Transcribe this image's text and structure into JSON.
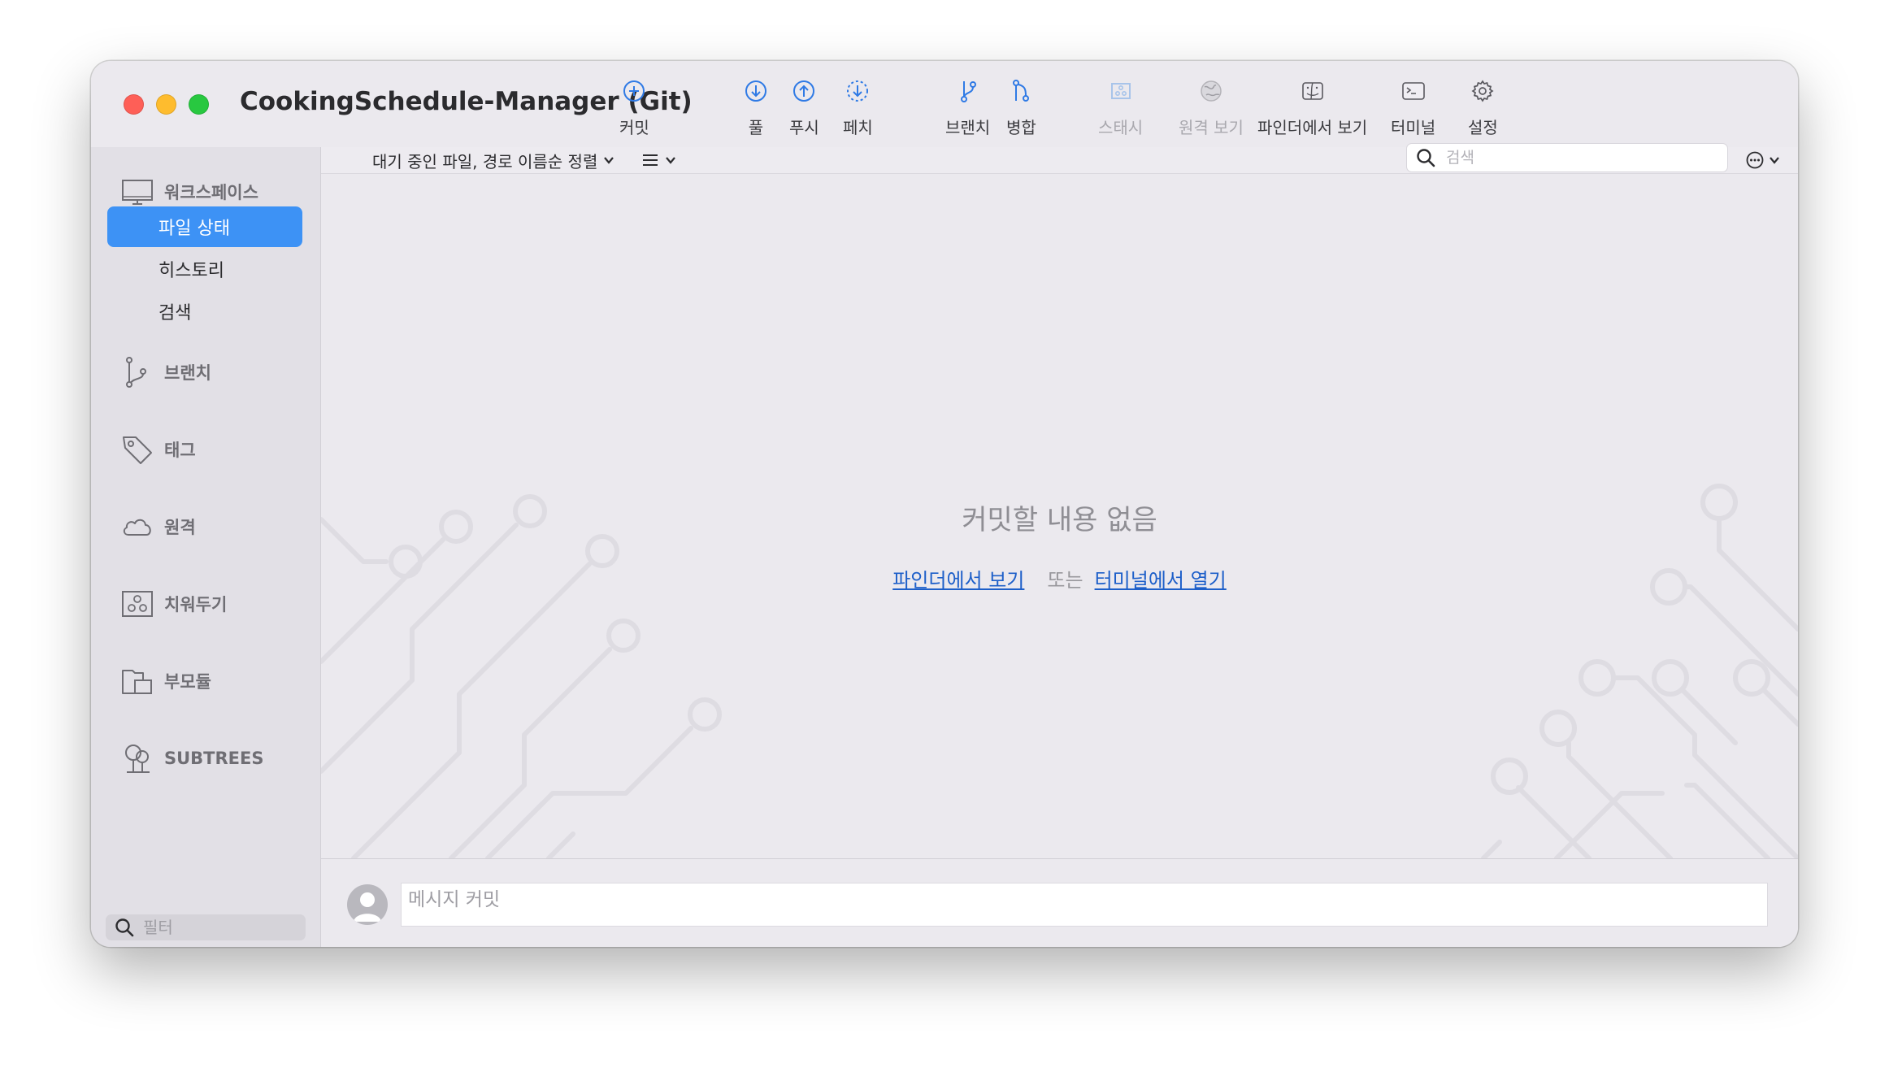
{
  "window": {
    "title": "CookingSchedule-Manager (Git)"
  },
  "toolbar": {
    "commit": "커밋",
    "pull": "풀",
    "push": "푸시",
    "fetch": "페치",
    "branch": "브랜치",
    "merge": "병합",
    "stash": "스태시",
    "remote_view": "원격 보기",
    "show_in_finder": "파인더에서 보기",
    "terminal": "터미널",
    "settings": "설정"
  },
  "sidebar": {
    "workspace": "워크스페이스",
    "file_status": "파일 상태",
    "history": "히스토리",
    "search": "검색",
    "branches": "브랜치",
    "tags": "태그",
    "remotes": "원격",
    "stashes": "치워두기",
    "submodules": "부모듈",
    "subtrees": "SUBTREES",
    "filter_placeholder": "필터"
  },
  "main": {
    "sort_label": "대기 중인 파일, 경로 이름순 정렬",
    "search_placeholder": "검색",
    "empty_title": "커밋할 내용 없음",
    "link_finder": "파인더에서 보기",
    "or_text": "또는",
    "link_terminal": "터미널에서 열기",
    "commit_placeholder": "메시지 커밋"
  },
  "colors": {
    "accent": "#3d92f5",
    "link": "#1d5fc9",
    "close": "#fe5f57",
    "minimize": "#febc2e",
    "zoom": "#28c840"
  }
}
